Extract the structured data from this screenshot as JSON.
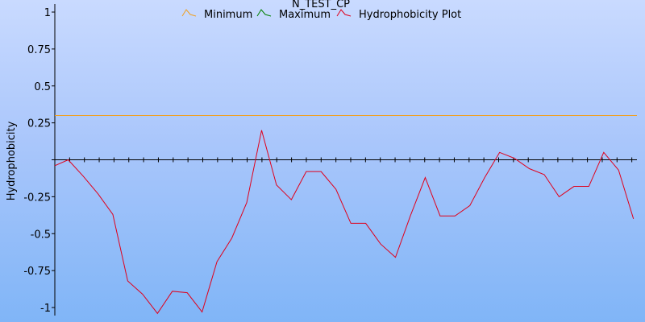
{
  "chart_data": {
    "type": "line",
    "title": "N_TEST_CP",
    "xlabel": "",
    "ylabel": "Hydrophobicity",
    "ylim": [
      -1,
      1
    ],
    "yticks": [
      1,
      0.75,
      0.5,
      0.25,
      0,
      -0.25,
      -0.5,
      -0.75,
      -1
    ],
    "ytick_labels": [
      "1",
      "0.75",
      "0.5",
      "0.25",
      "",
      "-0.25",
      "-0.5",
      "-0.75",
      "-1"
    ],
    "x": [
      0,
      1,
      2,
      3,
      4,
      5,
      6,
      7,
      8,
      9,
      10,
      11,
      12,
      13,
      14,
      15,
      16,
      17,
      18,
      19,
      20,
      21,
      22,
      23,
      24,
      25,
      26,
      27,
      28,
      29,
      30,
      31,
      32,
      33,
      34,
      35,
      36,
      37,
      38,
      39,
      40,
      41,
      42
    ],
    "xlim": [
      -0.9,
      39.5
    ],
    "legend_position": "top",
    "series": [
      {
        "name": "Minimum",
        "color": "#f0a020",
        "values": [
          0.3,
          0.3
        ]
      },
      {
        "name": "Maximum",
        "color": "#008000",
        "values": []
      },
      {
        "name": "Hydrophobicity Plot",
        "color": "#e0001b",
        "values": [
          -0.04,
          0.0,
          -0.11,
          -0.23,
          -0.37,
          -0.82,
          -0.91,
          -1.04,
          -0.89,
          -0.9,
          -1.03,
          -0.69,
          -0.53,
          -0.29,
          0.2,
          -0.17,
          -0.27,
          -0.08,
          -0.08,
          -0.2,
          -0.43,
          -0.43,
          -0.57,
          -0.66,
          -0.38,
          -0.12,
          -0.38,
          -0.38,
          -0.31,
          -0.12,
          0.05,
          0.01,
          -0.06,
          -0.1,
          -0.25,
          -0.18,
          -0.18,
          0.05,
          -0.07,
          -0.4
        ]
      }
    ]
  }
}
